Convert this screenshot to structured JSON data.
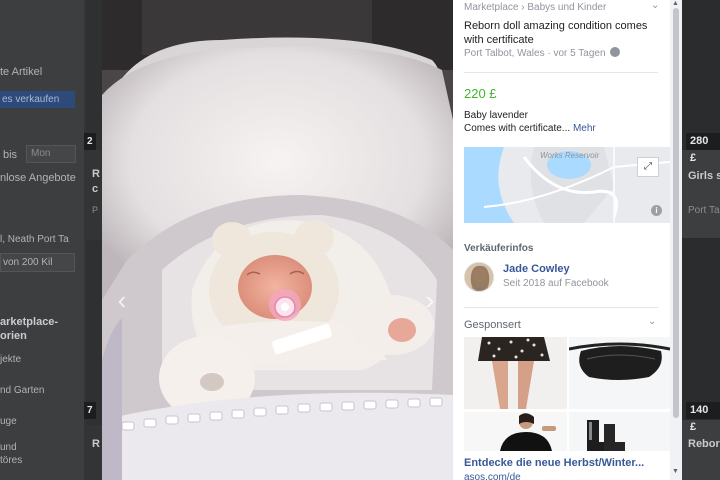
{
  "background": {
    "left_texts": [
      "te Artikel",
      "bis",
      "Mon",
      "nlose Angebote",
      "l, Neath Port Ta",
      "von 200 Kil",
      "arketplace-",
      "orien",
      "jekte",
      "nd Garten",
      "uge",
      "und",
      "töres"
    ],
    "sell_button": "es verkaufen",
    "right_price_top": "280 £",
    "right_price_bottom": "140 £",
    "right_title_top": "Girls s",
    "right_sub_top": "Port Talbo",
    "right_title_bottom": "Reborn",
    "mid_fragments": [
      "2",
      "R",
      "c",
      "P",
      "7",
      "R"
    ]
  },
  "listing": {
    "breadcrumb": "Marketplace › Babys und Kinder",
    "title": "Reborn doll amazing condition comes with certificate",
    "location": "Port Talbot, Wales · vor 5 Tagen",
    "price": "220 £",
    "description_line1": "Baby lavender",
    "description_line2": "Comes with certificate...",
    "more_link": "Mehr",
    "map_label": "Works Reservoir"
  },
  "seller": {
    "heading": "Verkäuferinfos",
    "name": "Jade Cowley",
    "since": "Seit 2018 auf Facebook"
  },
  "sponsored": {
    "heading": "Gesponsert",
    "ad_title": "Entdecke die neue Herbst/Winter...",
    "ad_domain": "asos.com/de"
  },
  "colors": {
    "price_green": "#42b72a",
    "link_blue": "#385898",
    "panel_bg": "#ffffff",
    "overlay_bg": "#3a3b3c"
  },
  "icons": [
    "chevron-left-icon",
    "chevron-right-icon",
    "globe-icon",
    "expand-icon",
    "info-icon",
    "chevron-down-icon"
  ]
}
